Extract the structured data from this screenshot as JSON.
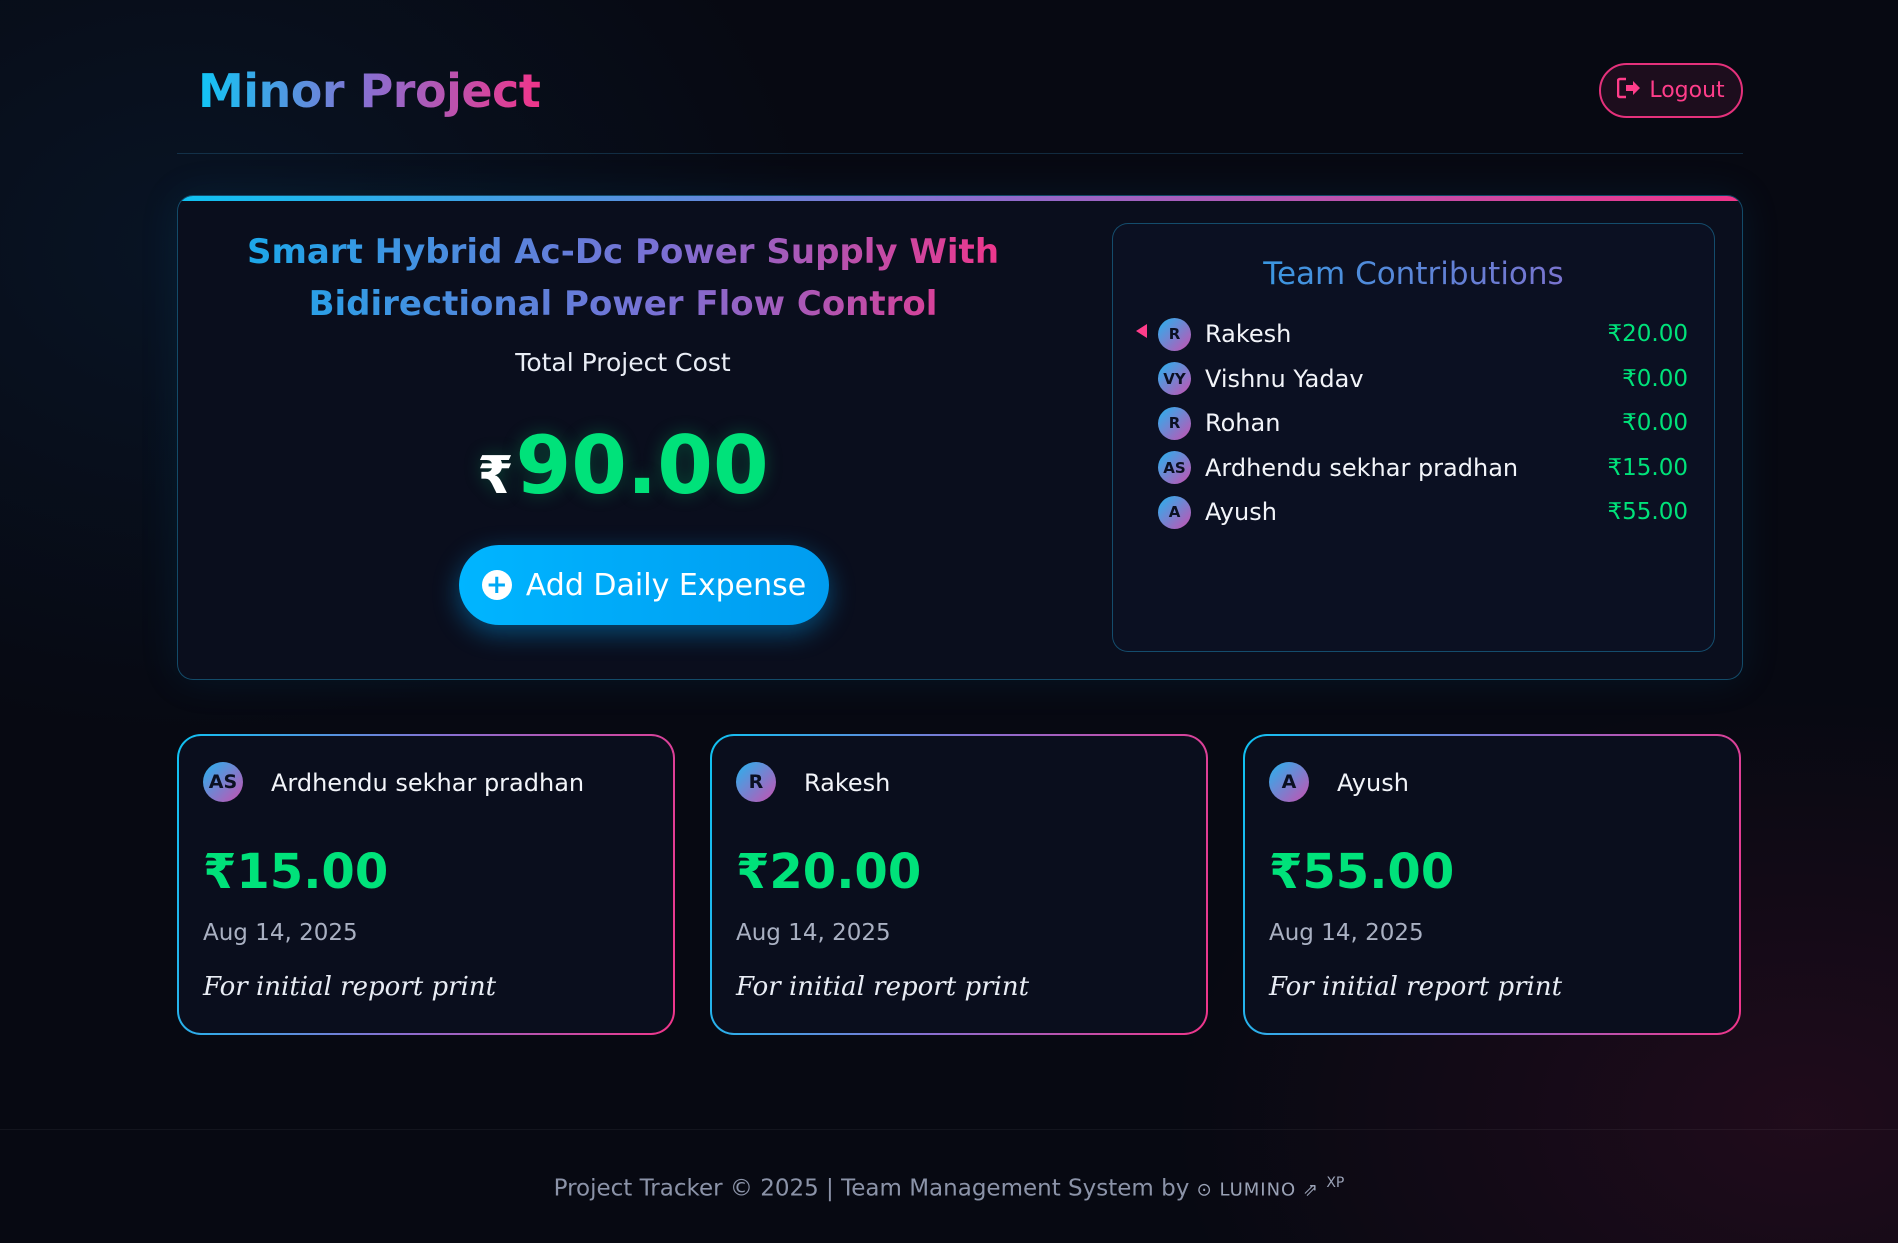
{
  "header": {
    "brand": "Minor Project",
    "logout_label": "Logout"
  },
  "project": {
    "title": "Smart Hybrid Ac-Dc Power Supply With Bidirectional Power Flow Control",
    "cost_label": "Total Project Cost",
    "currency_symbol": "₹",
    "total_cost": "90.00",
    "add_expense_label": "Add Daily Expense"
  },
  "contributions": {
    "title": "Team Contributions",
    "members": [
      {
        "initials": "R",
        "name": "Rakesh",
        "amount": "₹20.00"
      },
      {
        "initials": "VY",
        "name": "Vishnu Yadav",
        "amount": "₹0.00"
      },
      {
        "initials": "R",
        "name": "Rohan",
        "amount": "₹0.00"
      },
      {
        "initials": "AS",
        "name": "Ardhendu sekhar pradhan",
        "amount": "₹15.00"
      },
      {
        "initials": "A",
        "name": "Ayush",
        "amount": "₹55.00"
      }
    ]
  },
  "expenses": [
    {
      "initials": "AS",
      "name": "Ardhendu sekhar pradhan",
      "amount": "₹15.00",
      "date": "Aug 14, 2025",
      "note": "For initial report print"
    },
    {
      "initials": "R",
      "name": "Rakesh",
      "amount": "₹20.00",
      "date": "Aug 14, 2025",
      "note": "For initial report print"
    },
    {
      "initials": "A",
      "name": "Ayush",
      "amount": "₹55.00",
      "date": "Aug 14, 2025",
      "note": "For initial report print"
    }
  ],
  "footer": {
    "text": "Project Tracker © 2025 | Team Management System by",
    "brand": "⊙ LUMINO ⇗",
    "mark": "XP"
  },
  "colors": {
    "accent_cyan": "#0fc2f2",
    "accent_pink": "#f0358a",
    "money_green": "#00e27a",
    "background": "#070912"
  },
  "icons": {
    "logout": "sign-out-icon",
    "add": "plus-circle-icon",
    "pointer": "caret-left-icon"
  }
}
